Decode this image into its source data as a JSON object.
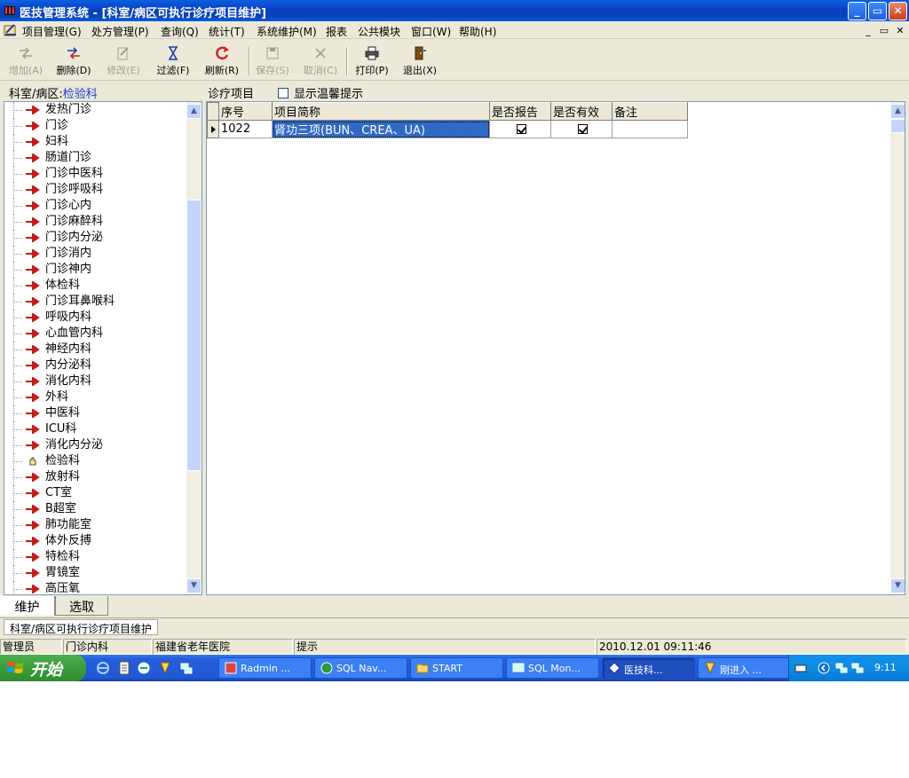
{
  "window": {
    "title": "医技管理系统 - [科室/病区可执行诊疗项目维护]",
    "minimize": "_",
    "restore": "▭",
    "close": "✕"
  },
  "menu": {
    "items": [
      "项目管理(G)",
      "处方管理(P)",
      "查询(Q)",
      "统计(T)",
      "系统维护(M)",
      "报表",
      "公共模块",
      "窗口(W)",
      "帮助(H)"
    ],
    "mdi_min": "_",
    "mdi_restore": "▭",
    "mdi_close": "✕"
  },
  "toolbar": {
    "add": "增加(A)",
    "delete": "删除(D)",
    "edit": "修改(E)",
    "filter": "过滤(F)",
    "refresh": "刷新(R)",
    "save": "保存(S)",
    "cancel": "取消(C)",
    "print": "打印(P)",
    "exit": "退出(X)"
  },
  "dept": {
    "label": "科室/病区:",
    "value": "检验科"
  },
  "project_label": "诊疗项目",
  "show_tips": {
    "label": "显示温馨提示",
    "checked": false
  },
  "tree": {
    "items": [
      "发热门诊",
      "门诊",
      "妇科",
      "肠道门诊",
      "门诊中医科",
      "门诊呼吸科",
      "门诊心内",
      "门诊麻醉科",
      "门诊内分泌",
      "门诊消内",
      "门诊神内",
      "体检科",
      "门诊耳鼻喉科",
      "呼吸内科",
      "心血管内科",
      "神经内科",
      "内分泌科",
      "消化内科",
      "外科",
      "中医科",
      "ICU科",
      "消化内分泌",
      "检验科",
      "放射科",
      "CT室",
      "B超室",
      "肺功能室",
      "体外反搏",
      "特检科",
      "胃镜室",
      "高压氧"
    ],
    "selected_index": 22
  },
  "grid": {
    "columns": [
      "序号",
      "项目简称",
      "是否报告",
      "是否有效",
      "备注"
    ],
    "rows": [
      {
        "seq": "1022",
        "name": "肾功三项(BUN、CREA、UA)",
        "report": true,
        "valid": true,
        "note": ""
      }
    ]
  },
  "tabs": {
    "maintain": "维护",
    "select": "选取"
  },
  "form_tab": "科室/病区可执行诊疗项目维护",
  "status": {
    "user": "管理员",
    "dept": "门诊内科",
    "hospital": "福建省老年医院",
    "hint": "提示",
    "datetime": "2010.12.01 09:11:46"
  },
  "taskbar": {
    "start": "开始",
    "tasks": [
      "Radmin ...",
      "SQL Nav...",
      "START",
      "SQL Mon...",
      "医技科...",
      "刚进入 ..."
    ],
    "active_index": 4,
    "clock": "9:11"
  }
}
